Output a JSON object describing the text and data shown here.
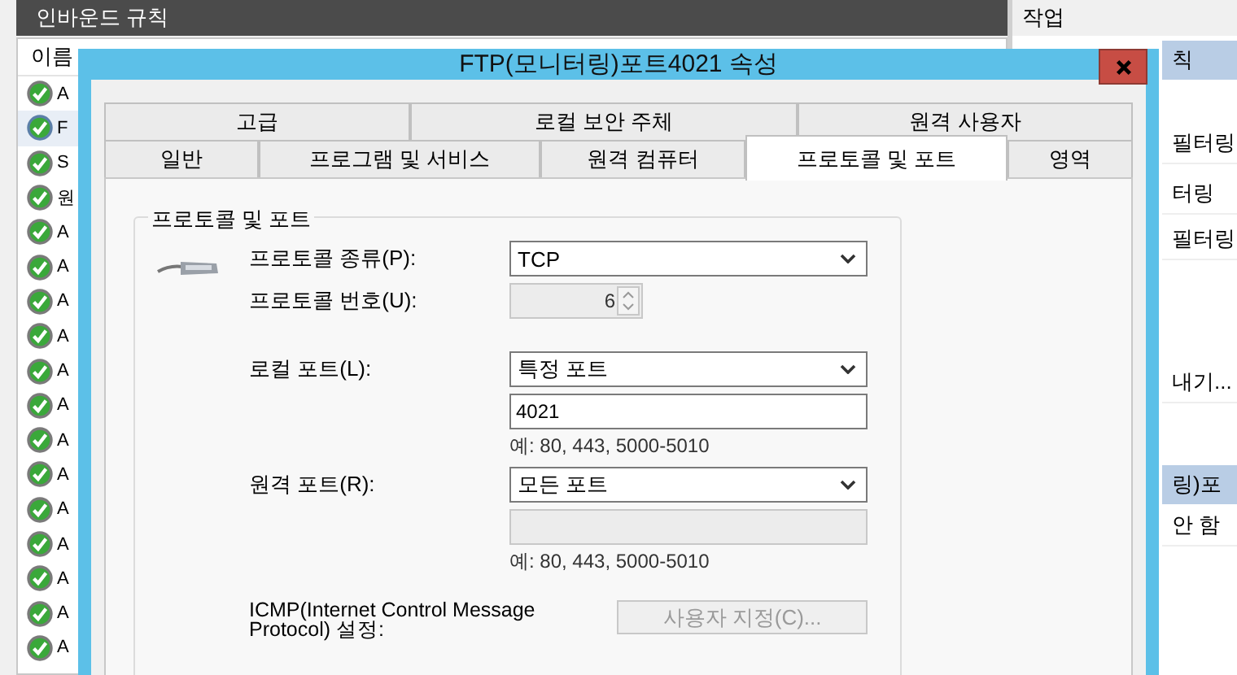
{
  "background_window": {
    "list_title": "인바운드 규칙",
    "column_1": "이름",
    "rules": [
      {
        "name": "A",
        "selected": false
      },
      {
        "name": "F",
        "selected": true
      },
      {
        "name": "S",
        "selected": false
      },
      {
        "name": "원",
        "selected": false
      },
      {
        "name": "A",
        "selected": false
      },
      {
        "name": "A",
        "selected": false
      },
      {
        "name": "A",
        "selected": false
      },
      {
        "name": "A",
        "selected": false
      },
      {
        "name": "A",
        "selected": false
      },
      {
        "name": "A",
        "selected": false
      },
      {
        "name": "A",
        "selected": false
      },
      {
        "name": "A",
        "selected": false
      },
      {
        "name": "A",
        "selected": false
      },
      {
        "name": "A",
        "selected": false
      },
      {
        "name": "A",
        "selected": false
      },
      {
        "name": "A",
        "selected": false
      },
      {
        "name": "A",
        "selected": false
      }
    ],
    "actions": {
      "title": "작업",
      "items": [
        {
          "label": "칙",
          "kind": "section"
        },
        {
          "label": "필터링",
          "kind": "item"
        },
        {
          "label": "터링",
          "kind": "item"
        },
        {
          "label": "필터링",
          "kind": "item"
        },
        {
          "label": "내기...",
          "kind": "item"
        },
        {
          "label": "링)포",
          "kind": "section"
        },
        {
          "label": "안 함",
          "kind": "item"
        }
      ]
    }
  },
  "dialog": {
    "title": "FTP(모니터링)포트4021 속성",
    "tabs_row_1": [
      {
        "label": "고급",
        "selected": false
      },
      {
        "label": "로컬 보안 주체",
        "selected": false
      },
      {
        "label": "원격 사용자",
        "selected": false
      }
    ],
    "tabs_row_2": [
      {
        "label": "일반",
        "selected": false
      },
      {
        "label": "프로그램 및 서비스",
        "selected": false
      },
      {
        "label": "원격 컴퓨터",
        "selected": false
      },
      {
        "label": "프로토콜 및 포트",
        "selected": true
      },
      {
        "label": "영역",
        "selected": false
      }
    ],
    "group_title": "프로토콜 및 포트",
    "protocol_type": {
      "label": "프로토콜 종류(P):",
      "value": "TCP"
    },
    "protocol_number": {
      "label": "프로토콜 번호(U):",
      "value": "6",
      "disabled": true
    },
    "local_port": {
      "label": "로컬 포트(L):",
      "value": "특정 포트",
      "port_value": "4021",
      "port_disabled": false,
      "hint": "예: 80, 443, 5000-5010"
    },
    "remote_port": {
      "label": "원격 포트(R):",
      "value": "모든 포트",
      "port_disabled": true,
      "hint": "예: 80, 443, 5000-5010"
    },
    "icmp": {
      "label": "ICMP(Internet Control Message Protocol) 설정:",
      "button": "사용자 지정(C)...",
      "disabled": true
    }
  }
}
